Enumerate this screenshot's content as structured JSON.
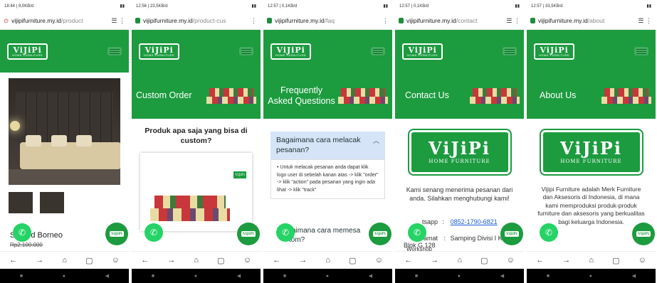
{
  "colors": {
    "brand_green": "#1c9b3f",
    "whatsapp": "#25d366"
  },
  "screens": [
    {
      "status_time": "18:44 | 9,0KB/d",
      "url_domain": "vijipifurniture.my.id",
      "url_path": "/product",
      "product_title": "Sofa Bed Borneo",
      "product_title_visible": "S",
      "product_title_tail": "d Borneo",
      "price": "Rp2.100.000"
    },
    {
      "status_time": "12:56 | 23,5KB/d",
      "url_domain": "vijipifurniture.my.id",
      "url_path": "/product-cus",
      "banner_title": "Custom Order",
      "question": "Produk apa saja yang bisa di custom?"
    },
    {
      "status_time": "12:57 | 0,1KB/d",
      "url_domain": "vijipifurniture.my.id",
      "url_path": "/faq",
      "banner_title": "Frequently Asked Questions",
      "faq1_question": "Bagaimana cara melacak pesanan?",
      "faq1_answer": "Untuk melacak pesanan anda dapat klik logo user di sebelah kanan atas -> klik \"order\" -> klik \"action\" pada pesanan yang ingin ada lihat -> klik \"track\"",
      "faq2_question": "aimana cara memesan ukuran custom?",
      "faq2_visible": "aimana cara memesa",
      "faq2_line2": "tom?"
    },
    {
      "status_time": "12:57 | 0,1KB/d",
      "url_domain": "vijipifurniture.my.id",
      "url_path": "/contact",
      "banner_title": "Contact Us",
      "intro": "Kami senang menerima pesanan dari anda. Silahkan menghubungi kami!",
      "wa_label": "tsapp",
      "wa_value": "0852-1790-6821",
      "addr_label": "amat",
      "addr_value": "Samping Divisi I Kostrad Blok G 128",
      "addr_extra": "Workshop"
    },
    {
      "status_time": "12:57 | 33,5KB/d",
      "url_domain": "vijipifurniture.my.id",
      "url_path": "/about",
      "banner_title": "About Us",
      "about": "Vijipi Furniture adalah Merk Furniture dan Aksesoris di Indonesia, di mana kami memproduksi produk-produk furniture dan aksesoris yang berkualitas bagi keluarga Indonesia."
    }
  ],
  "logo": {
    "main": "ViJiPi",
    "sub": "HOME FURNITURE"
  },
  "fab_label": "ViJiPi"
}
